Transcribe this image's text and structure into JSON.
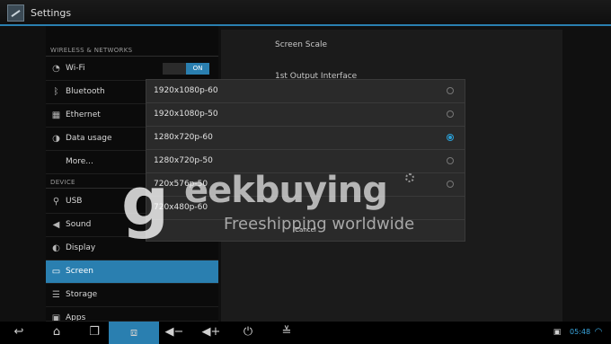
{
  "titlebar": {
    "title": "Settings"
  },
  "sections": {
    "wireless": "WIRELESS & NETWORKS",
    "device": "DEVICE"
  },
  "menu": {
    "wifi": "Wi-Fi",
    "wifi_toggle": "ON",
    "bluetooth": "Bluetooth",
    "ethernet": "Ethernet",
    "data_usage": "Data usage",
    "more": "More...",
    "usb": "USB",
    "sound": "Sound",
    "display": "Display",
    "screen": "Screen",
    "storage": "Storage",
    "apps": "Apps"
  },
  "right_panel": {
    "screen_scale": "Screen Scale",
    "output_interface": "1st Output Interface"
  },
  "dialog": {
    "options": [
      "1920x1080p-60",
      "1920x1080p-50",
      "1280x720p-60",
      "1280x720p-50",
      "720x576p-50",
      "720x480p-60"
    ],
    "selected_index": 2,
    "cancel": "Cancel"
  },
  "watermark": {
    "letter": "g",
    "brand": "eekbuying",
    "tagline": "Freeshipping worldwide"
  },
  "status": {
    "time": "05:48"
  }
}
